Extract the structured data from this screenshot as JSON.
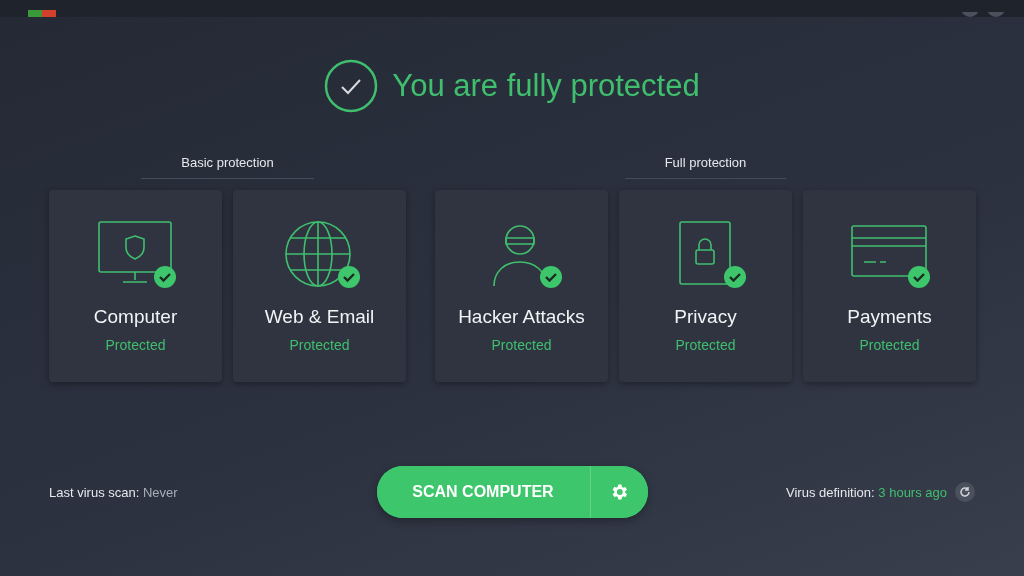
{
  "headline": "You are fully protected",
  "groups": [
    {
      "label": "Basic protection",
      "cards": [
        {
          "kind": "computer",
          "title": "Computer",
          "status": "Protected"
        },
        {
          "kind": "globe",
          "title": "Web & Email",
          "status": "Protected"
        }
      ]
    },
    {
      "label": "Full protection",
      "cards": [
        {
          "kind": "hacker",
          "title": "Hacker Attacks",
          "status": "Protected"
        },
        {
          "kind": "privacy",
          "title": "Privacy",
          "status": "Protected"
        },
        {
          "kind": "card",
          "title": "Payments",
          "status": "Protected"
        }
      ]
    }
  ],
  "last_scan": {
    "label": "Last virus scan:",
    "value": "Never"
  },
  "scan_button": "SCAN COMPUTER",
  "virus_definition": {
    "label": "Virus definition:",
    "value": "3 hours ago"
  }
}
